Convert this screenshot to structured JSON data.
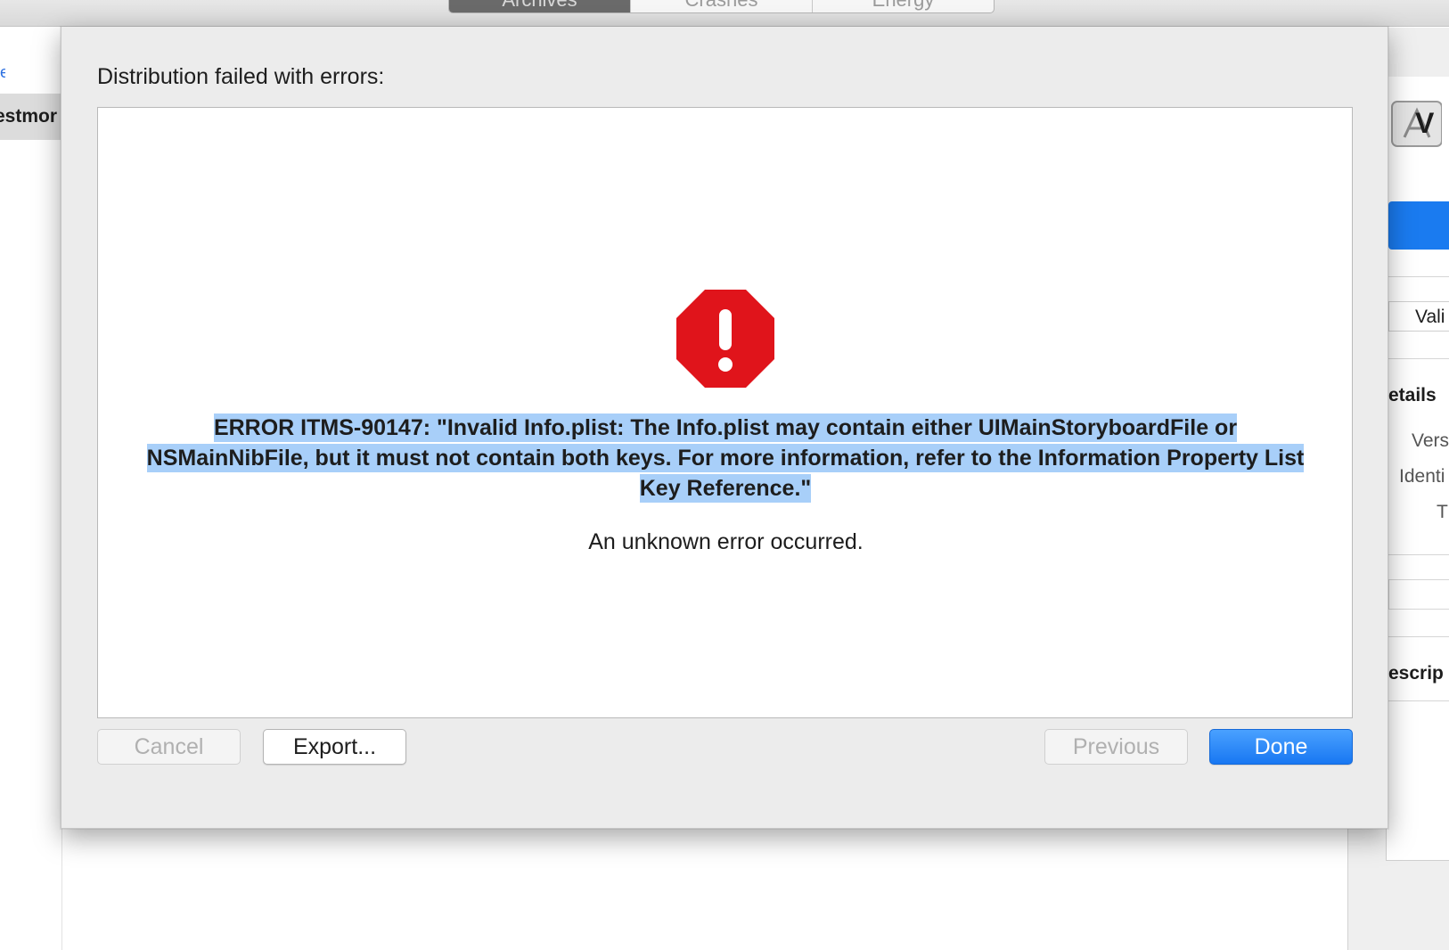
{
  "background": {
    "tabs": [
      {
        "label": "Archives",
        "active": true
      },
      {
        "label": "Crashes",
        "active": false
      },
      {
        "label": "Energy",
        "active": false
      }
    ],
    "sidebar_selected": "estmor",
    "right_panel": {
      "status_field": "Vali",
      "details_heading": "etails",
      "version_label": "Vers",
      "identifier_label": "Identi",
      "team_label": "T",
      "description_heading": "escrip"
    }
  },
  "dialog": {
    "title": "Distribution failed with errors:",
    "error_text": "ERROR ITMS-90147: \"Invalid Info.plist: The Info.plist may contain either UIMainStoryboardFile or NSMainNibFile, but it must not contain both keys. For more information, refer to the Information Property List Key Reference.\"",
    "detail_text": "An unknown error occurred.",
    "icon": "stop-error-icon",
    "buttons": {
      "cancel": "Cancel",
      "export": "Export...",
      "previous": "Previous",
      "done": "Done"
    }
  },
  "colors": {
    "accent": "#1a7bf0",
    "error_red": "#e0141b",
    "selection": "#a8cff9"
  }
}
